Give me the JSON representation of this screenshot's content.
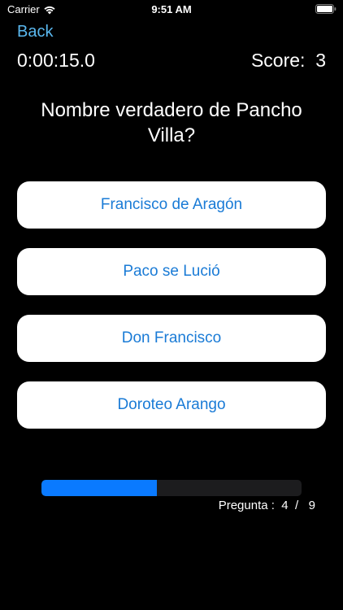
{
  "status_bar": {
    "carrier": "Carrier",
    "time": "9:51 AM"
  },
  "nav": {
    "back_label": "Back"
  },
  "header": {
    "timer": "0:00:15.0",
    "score_label": "Score:",
    "score_value": "3"
  },
  "question": {
    "text": "Nombre verdadero de Pancho Villa?"
  },
  "answers": [
    {
      "label": "Francisco de Aragón"
    },
    {
      "label": "Paco se Lució"
    },
    {
      "label": "Don Francisco"
    },
    {
      "label": "Doroteo Arango"
    }
  ],
  "progress": {
    "label": "Pregunta :",
    "current": "4",
    "separator": "/",
    "total": "9",
    "fraction": 0.444
  },
  "colors": {
    "background": "#000000",
    "accent": "#0a7aff",
    "back_link": "#5ab8ef",
    "answer_text": "#1a7bd6",
    "answer_bg": "#ffffff"
  }
}
